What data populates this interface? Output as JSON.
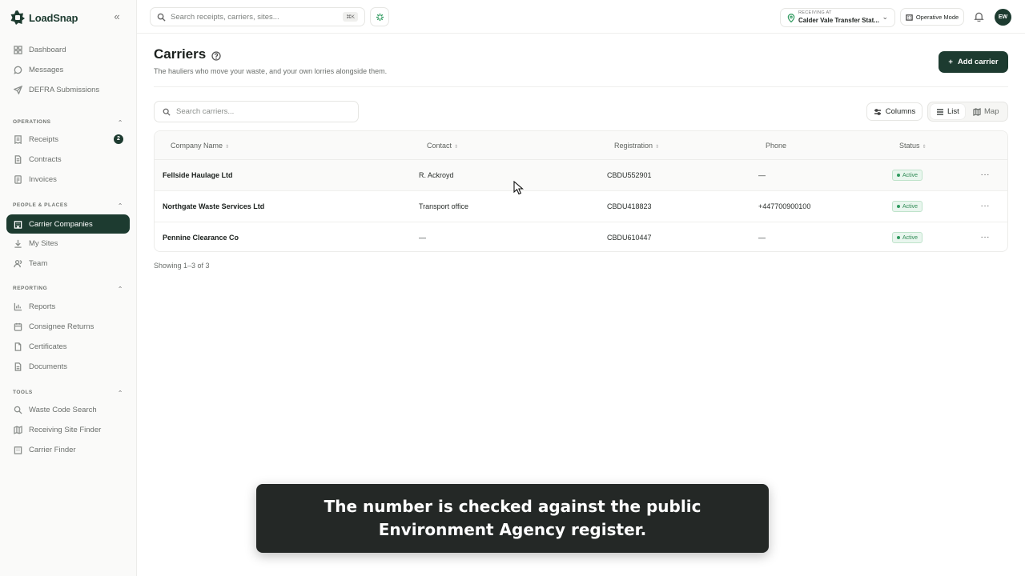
{
  "brand": {
    "name": "LoadSnap",
    "color": "#1d3b30"
  },
  "sidebar": {
    "top_items": [
      {
        "label": "Dashboard",
        "icon": "dashboard-icon"
      },
      {
        "label": "Messages",
        "icon": "message-icon"
      },
      {
        "label": "DEFRA Submissions",
        "icon": "send-icon"
      }
    ],
    "sections": [
      {
        "title": "OPERATIONS",
        "items": [
          {
            "label": "Receipts",
            "icon": "receipt-icon",
            "badge": "2"
          },
          {
            "label": "Contracts",
            "icon": "contract-icon"
          },
          {
            "label": "Invoices",
            "icon": "invoice-icon"
          }
        ]
      },
      {
        "title": "PEOPLE & PLACES",
        "items": [
          {
            "label": "Carrier Companies",
            "icon": "building-icon",
            "active": true
          },
          {
            "label": "My Sites",
            "icon": "download-icon"
          },
          {
            "label": "Team",
            "icon": "users-icon"
          }
        ]
      },
      {
        "title": "REPORTING",
        "items": [
          {
            "label": "Reports",
            "icon": "bar-chart-icon"
          },
          {
            "label": "Consignee Returns",
            "icon": "calendar-icon"
          },
          {
            "label": "Certificates",
            "icon": "certificate-icon"
          },
          {
            "label": "Documents",
            "icon": "document-icon"
          }
        ]
      },
      {
        "title": "TOOLS",
        "items": [
          {
            "label": "Waste Code Search",
            "icon": "search-icon"
          },
          {
            "label": "Receiving Site Finder",
            "icon": "map-icon"
          },
          {
            "label": "Carrier Finder",
            "icon": "truck-icon"
          }
        ]
      }
    ]
  },
  "topbar": {
    "search_placeholder": "Search receipts, carriers, sites...",
    "search_shortcut": "⌘K",
    "site_label": "RECEIVING AT",
    "site_value": "Calder Vale Transfer Stat...",
    "mode_label": "Operative Mode",
    "avatar_initials": "EW"
  },
  "page": {
    "title": "Carriers",
    "subtitle": "The hauliers who move your waste, and your own lorries alongside them.",
    "add_button": "Add carrier",
    "search_placeholder": "Search carriers...",
    "columns_button": "Columns",
    "view_list": "List",
    "view_map": "Map"
  },
  "table": {
    "headers": [
      "Company Name",
      "Contact",
      "Registration",
      "Phone",
      "Status"
    ],
    "rows": [
      {
        "company": "Fellside Haulage Ltd",
        "contact": "R. Ackroyd",
        "registration": "CBDU552901",
        "phone": "—",
        "status": "Active"
      },
      {
        "company": "Northgate Waste Services Ltd",
        "contact": "Transport office",
        "registration": "CBDU418823",
        "phone": "+447700900100",
        "status": "Active"
      },
      {
        "company": "Pennine Clearance Co",
        "contact": "—",
        "registration": "CBDU610447",
        "phone": "—",
        "status": "Active"
      }
    ],
    "footer": "Showing 1–3 of 3"
  },
  "caption": "The number is checked against the public Environment Agency register."
}
